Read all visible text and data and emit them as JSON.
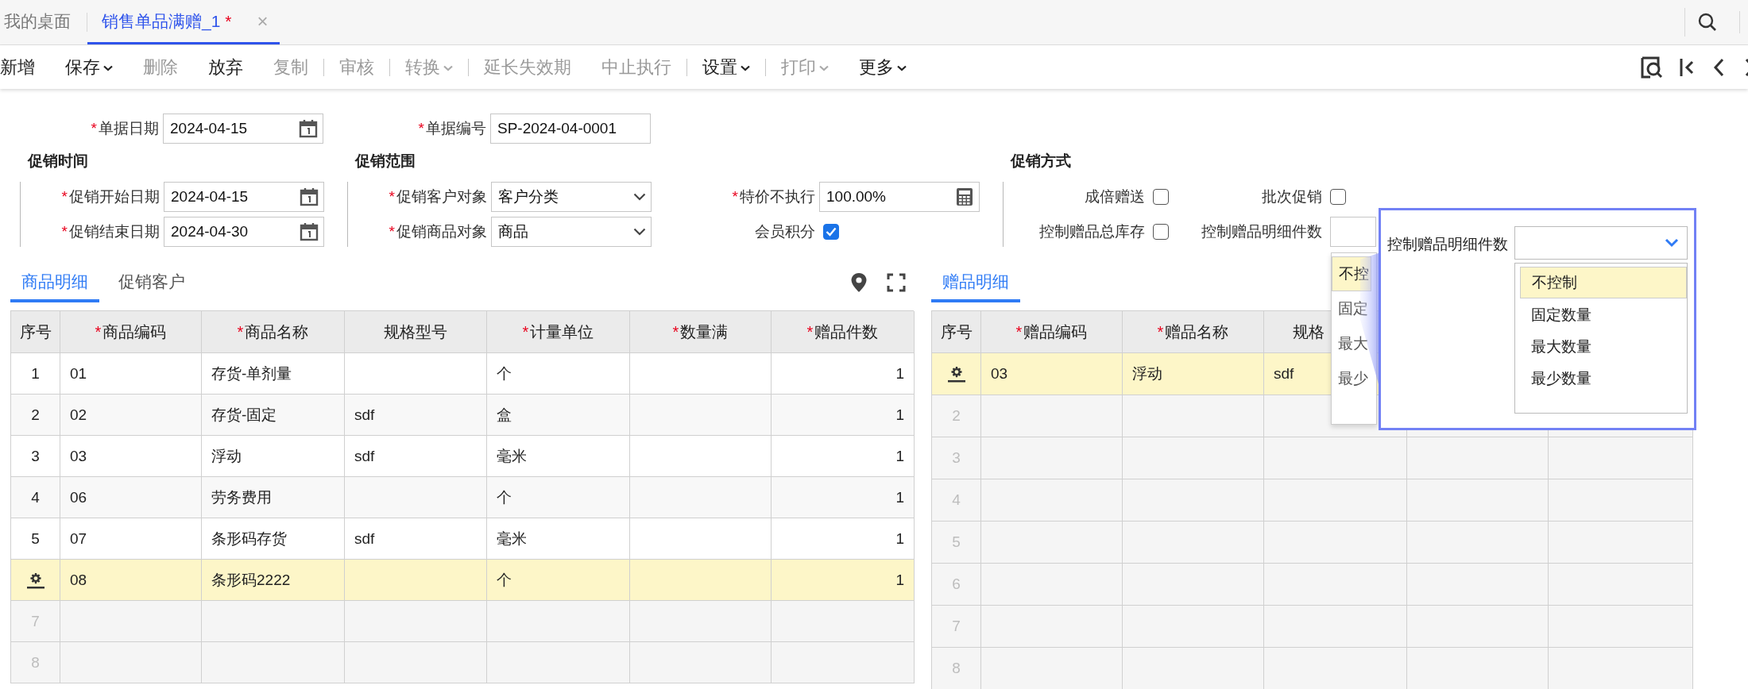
{
  "tabs": [
    {
      "label": "我的桌面",
      "selected": false
    },
    {
      "label": "销售单品满赠_1",
      "selected": true,
      "mark": "*",
      "close": "×"
    }
  ],
  "toolbar": [
    {
      "kind": "button",
      "label": "新增",
      "disabled": false,
      "dropdown": false
    },
    {
      "kind": "button",
      "label": "保存",
      "disabled": false,
      "dropdown": true
    },
    {
      "kind": "button",
      "label": "删除",
      "disabled": true,
      "dropdown": false
    },
    {
      "kind": "button",
      "label": "放弃",
      "disabled": false,
      "dropdown": false
    },
    {
      "kind": "button",
      "label": "复制",
      "disabled": true,
      "dropdown": false
    },
    {
      "kind": "separator"
    },
    {
      "kind": "button",
      "label": "审核",
      "disabled": true,
      "dropdown": false
    },
    {
      "kind": "separator"
    },
    {
      "kind": "button",
      "label": "转换",
      "disabled": true,
      "dropdown": true
    },
    {
      "kind": "separator"
    },
    {
      "kind": "button",
      "label": "延长失效期",
      "disabled": true,
      "dropdown": false
    },
    {
      "kind": "button",
      "label": "中止执行",
      "disabled": true,
      "dropdown": false
    },
    {
      "kind": "separator"
    },
    {
      "kind": "button",
      "label": "设置",
      "disabled": false,
      "dropdown": true
    },
    {
      "kind": "separator"
    },
    {
      "kind": "button",
      "label": "打印",
      "disabled": true,
      "dropdown": true
    },
    {
      "kind": "button",
      "label": "更多",
      "disabled": false,
      "dropdown": true
    }
  ],
  "header_fields": [
    {
      "label": "单据日期",
      "mark": "*",
      "kind": "date",
      "value": "2024-04-15"
    },
    {
      "label": "单据编号",
      "mark": "*",
      "kind": "text",
      "value": "SP-2024-04-0001"
    }
  ],
  "sections": [
    {
      "title": "促销时间",
      "rows": [
        [
          {
            "label": "促销开始日期",
            "mark": "*",
            "kind": "date",
            "value": "2024-04-15"
          }
        ],
        [
          {
            "label": "促销结束日期",
            "mark": "*",
            "kind": "date",
            "value": "2024-04-30"
          }
        ]
      ]
    },
    {
      "title": "促销范围",
      "rows": [
        [
          {
            "label": "促销客户对象",
            "mark": "*",
            "kind": "select",
            "value": "客户分类"
          },
          {
            "label": "特价不执行",
            "mark": "*",
            "kind": "number",
            "value": "100.00%"
          }
        ],
        [
          {
            "label": "促销商品对象",
            "mark": "*",
            "kind": "select",
            "value": "商品"
          },
          {
            "label": "会员积分",
            "kind": "checkbox",
            "checked": true
          }
        ]
      ]
    },
    {
      "title": "促销方式",
      "rows": [
        [
          {
            "label": "成倍赠送",
            "kind": "checkbox",
            "checked": false
          },
          {
            "label": "批次促销",
            "kind": "checkbox",
            "checked": false
          }
        ],
        [
          {
            "label": "控制赠品总库存",
            "kind": "checkbox",
            "checked": false
          },
          {
            "label": "控制赠品明细件数",
            "kind": "dropdown"
          }
        ]
      ]
    }
  ],
  "dropdown_list": [
    {
      "label": "不控",
      "selected": true
    },
    {
      "label": "固定",
      "selected": false
    },
    {
      "label": "最大",
      "selected": false
    },
    {
      "label": "最少",
      "selected": false
    }
  ],
  "zoom_callout": {
    "label": "控制赠品明细件数",
    "options": [
      {
        "label": "不控制",
        "selected": true
      },
      {
        "label": "固定数量",
        "selected": false
      },
      {
        "label": "最大数量",
        "selected": false
      },
      {
        "label": "最少数量",
        "selected": false
      }
    ]
  },
  "product_panel": {
    "tabs": [
      {
        "label": "商品明细",
        "selected": true
      },
      {
        "label": "促销客户",
        "selected": false
      }
    ],
    "columns": [
      {
        "label": "序号"
      },
      {
        "label": "商品编码",
        "mark": "*"
      },
      {
        "label": "商品名称",
        "mark": "*"
      },
      {
        "label": "规格型号"
      },
      {
        "label": "计量单位",
        "mark": "*"
      },
      {
        "label": "数量满",
        "mark": "*"
      },
      {
        "label": "赠品件数",
        "mark": "*"
      }
    ],
    "rows": [
      {
        "cells": [
          "1",
          "01",
          "存货-单剂量",
          null,
          "个",
          null,
          "1"
        ],
        "selected": false
      },
      {
        "cells": [
          "2",
          "02",
          "存货-固定",
          "sdf",
          "盒",
          null,
          "1"
        ],
        "selected": false
      },
      {
        "cells": [
          "3",
          "03",
          "浮动",
          "sdf",
          "毫米",
          null,
          "1"
        ],
        "selected": false
      },
      {
        "cells": [
          "4",
          "06",
          "劳务费用",
          null,
          "个",
          null,
          "1"
        ],
        "selected": false
      },
      {
        "cells": [
          "5",
          "07",
          "条形码存货",
          "sdf",
          "毫米",
          null,
          "1"
        ],
        "selected": false
      },
      {
        "cells": [
          null,
          "08",
          "条形码2222",
          null,
          "个",
          null,
          "1"
        ],
        "selected": true
      }
    ],
    "empty_rows": [
      "7",
      "8"
    ]
  },
  "gift_panel": {
    "tabs": [
      {
        "label": "赠品明细",
        "selected": true
      }
    ],
    "columns": [
      {
        "label": "序号"
      },
      {
        "label": "赠品编码",
        "mark": "*"
      },
      {
        "label": "赠品名称",
        "mark": "*"
      },
      {
        "label": "规格",
        "cut": true
      }
    ],
    "rows": [
      {
        "cells": [
          null,
          "03",
          "浮动",
          "sdf"
        ],
        "selected": true
      }
    ],
    "empty_rows": [
      "2",
      "3",
      "4",
      "5",
      "6",
      "7",
      "8"
    ]
  }
}
